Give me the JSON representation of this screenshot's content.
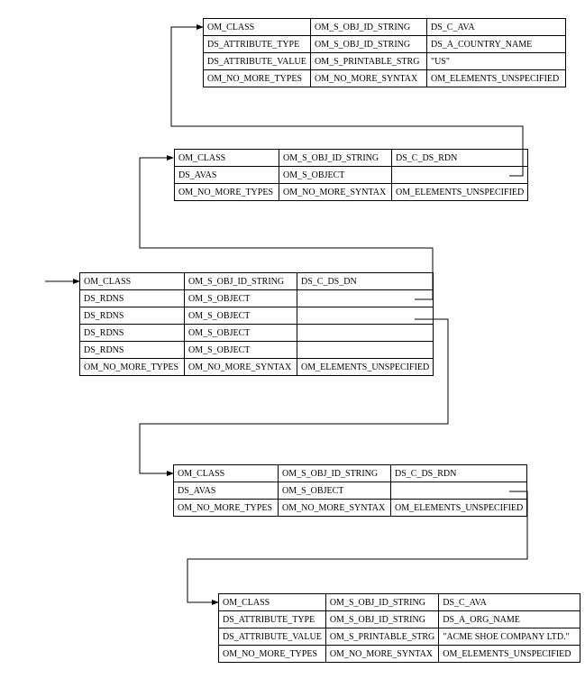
{
  "table1": {
    "r0": {
      "c0": "OM_CLASS",
      "c1": "OM_S_OBJ_ID_STRING",
      "c2": "DS_C_AVA"
    },
    "r1": {
      "c0": "DS_ATTRIBUTE_TYPE",
      "c1": "OM_S_OBJ_ID_STRING",
      "c2": "DS_A_COUNTRY_NAME"
    },
    "r2": {
      "c0": "DS_ATTRIBUTE_VALUE",
      "c1": "OM_S_PRINTABLE_STRG",
      "c2": "\"US\""
    },
    "r3": {
      "c0": "OM_NO_MORE_TYPES",
      "c1": "OM_NO_MORE_SYNTAX",
      "c2": "OM_ELEMENTS_UNSPECIFIED"
    }
  },
  "table2": {
    "r0": {
      "c0": "OM_CLASS",
      "c1": "OM_S_OBJ_ID_STRING",
      "c2": "DS_C_DS_RDN"
    },
    "r1": {
      "c0": "DS_AVAS",
      "c1": "OM_S_OBJECT",
      "c2": ""
    },
    "r2": {
      "c0": "OM_NO_MORE_TYPES",
      "c1": "OM_NO_MORE_SYNTAX",
      "c2": "OM_ELEMENTS_UNSPECIFIED"
    }
  },
  "table3": {
    "r0": {
      "c0": "OM_CLASS",
      "c1": "OM_S_OBJ_ID_STRING",
      "c2": "DS_C_DS_DN"
    },
    "r1": {
      "c0": "DS_RDNS",
      "c1": "OM_S_OBJECT",
      "c2": ""
    },
    "r2": {
      "c0": "DS_RDNS",
      "c1": "OM_S_OBJECT",
      "c2": ""
    },
    "r3": {
      "c0": "DS_RDNS",
      "c1": "OM_S_OBJECT",
      "c2": ""
    },
    "r4": {
      "c0": "DS_RDNS",
      "c1": "OM_S_OBJECT",
      "c2": ""
    },
    "r5": {
      "c0": "OM_NO_MORE_TYPES",
      "c1": "OM_NO_MORE_SYNTAX",
      "c2": "OM_ELEMENTS_UNSPECIFIED"
    }
  },
  "table4": {
    "r0": {
      "c0": "OM_CLASS",
      "c1": "OM_S_OBJ_ID_STRING",
      "c2": "DS_C_DS_RDN"
    },
    "r1": {
      "c0": "DS_AVAS",
      "c1": "OM_S_OBJECT",
      "c2": ""
    },
    "r2": {
      "c0": "OM_NO_MORE_TYPES",
      "c1": "OM_NO_MORE_SYNTAX",
      "c2": "OM_ELEMENTS_UNSPECIFIED"
    }
  },
  "table5": {
    "r0": {
      "c0": "OM_CLASS",
      "c1": "OM_S_OBJ_ID_STRING",
      "c2": "DS_C_AVA"
    },
    "r1": {
      "c0": "DS_ATTRIBUTE_TYPE",
      "c1": "OM_S_OBJ_ID_STRING",
      "c2": "DS_A_ORG_NAME"
    },
    "r2": {
      "c0": "DS_ATTRIBUTE_VALUE",
      "c1": "OM_S_PRINTABLE_STRG",
      "c2": "\"ACME SHOE COMPANY LTD.\""
    },
    "r3": {
      "c0": "OM_NO_MORE_TYPES",
      "c1": "OM_NO_MORE_SYNTAX",
      "c2": "OM_ELEMENTS_UNSPECIFIED"
    }
  }
}
